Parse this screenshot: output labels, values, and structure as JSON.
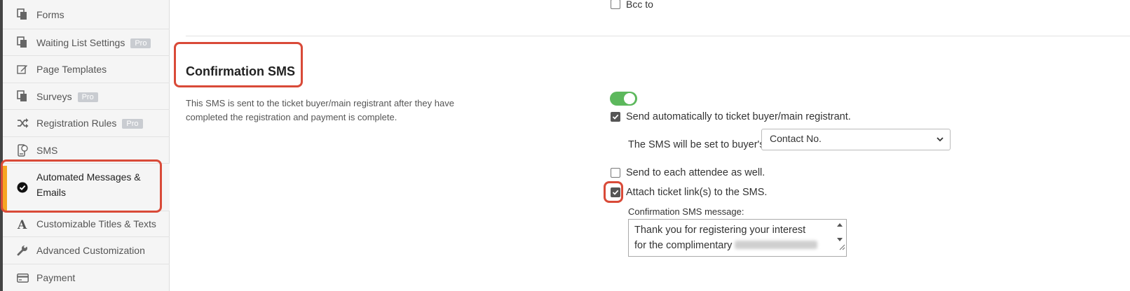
{
  "sidebar": {
    "items": [
      {
        "label": "Forms",
        "icon": "copy-icon",
        "badge": ""
      },
      {
        "label": "Waiting List Settings",
        "icon": "copy-icon",
        "badge": "Pro"
      },
      {
        "label": "Page Templates",
        "icon": "edit-icon",
        "badge": ""
      },
      {
        "label": "Surveys",
        "icon": "copy-icon",
        "badge": "Pro"
      },
      {
        "label": "Registration Rules",
        "icon": "shuffle-icon",
        "badge": "Pro"
      },
      {
        "label": "SMS",
        "icon": "sms-phone-icon",
        "badge": ""
      },
      {
        "label": "Automated Messages & Emails",
        "icon": "check-circle-icon",
        "badge": ""
      },
      {
        "label": "Customizable Titles & Texts",
        "icon": "font-icon",
        "badge": ""
      },
      {
        "label": "Advanced Customization",
        "icon": "wrench-icon",
        "badge": ""
      },
      {
        "label": "Payment",
        "icon": "credit-card-icon",
        "badge": ""
      }
    ],
    "active_line1": "Automated Messages &",
    "active_line2": "Emails"
  },
  "main": {
    "bcc_label": "Bcc to",
    "section_title": "Confirmation SMS",
    "description": "This SMS is sent to the ticket buyer/main registrant after they have completed the registration and payment is complete.",
    "enabled": true,
    "send_auto_label": "Send automatically to ticket buyer/main registrant.",
    "buyer_field_label": "The SMS will be set to buyer's:",
    "buyer_field_value": "Contact No.",
    "send_each_label": "Send to each attendee as well.",
    "attach_link_label": "Attach ticket link(s) to the SMS.",
    "message_label": "Confirmation SMS message:",
    "message_line1": "Thank you for registering your interest",
    "message_line2": "for the complimentary"
  },
  "colors": {
    "accent_orange": "#f5a623",
    "toggle_green": "#5cb85c",
    "highlight_red": "#d94a38"
  }
}
